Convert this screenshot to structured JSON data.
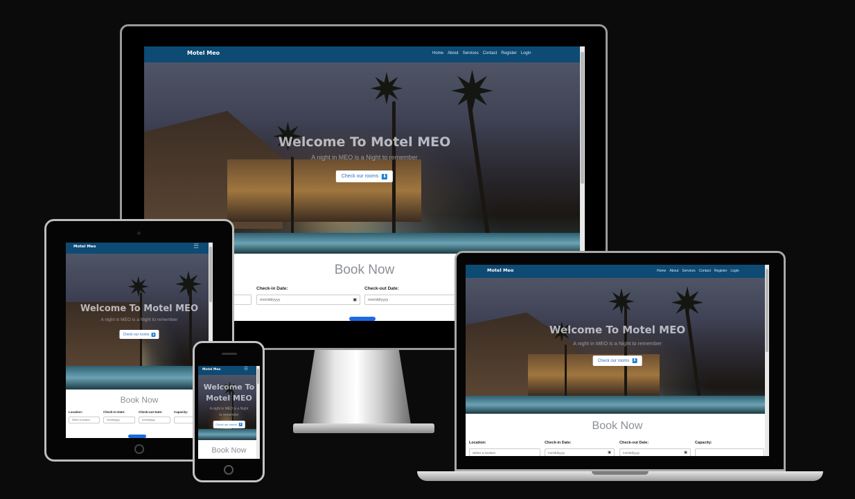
{
  "site": {
    "brand": "Motel Meo",
    "nav_links": [
      "Home",
      "About",
      "Services",
      "Contact",
      "Register",
      "Login"
    ],
    "hero_title": "Welcome To Motel MEO",
    "hero_title_line1": "Welcome To",
    "hero_title_line2": "Motel MEO",
    "hero_subtitle": "A night in MEO is a Night to remember",
    "hero_subtitle_line1": "A night in MEO is a Night",
    "hero_subtitle_line2": "to remember",
    "hero_button": "Check our rooms",
    "hero_button_icon": "⬇",
    "book_title": "Book Now",
    "form": {
      "location_label": "Location:",
      "location_placeholder": "Select a location",
      "checkin_label": "Check-in Date:",
      "checkout_label": "Check-out Date:",
      "date_placeholder": "mm/dd/yyyy",
      "capacity_label": "Capacity:"
    },
    "hamburger_icon": "☰",
    "calendar_icon": "▣"
  },
  "colors": {
    "nav": "#0d4a74",
    "button_accent": "#1d6ae0",
    "page_background": "#0b0b0b"
  }
}
